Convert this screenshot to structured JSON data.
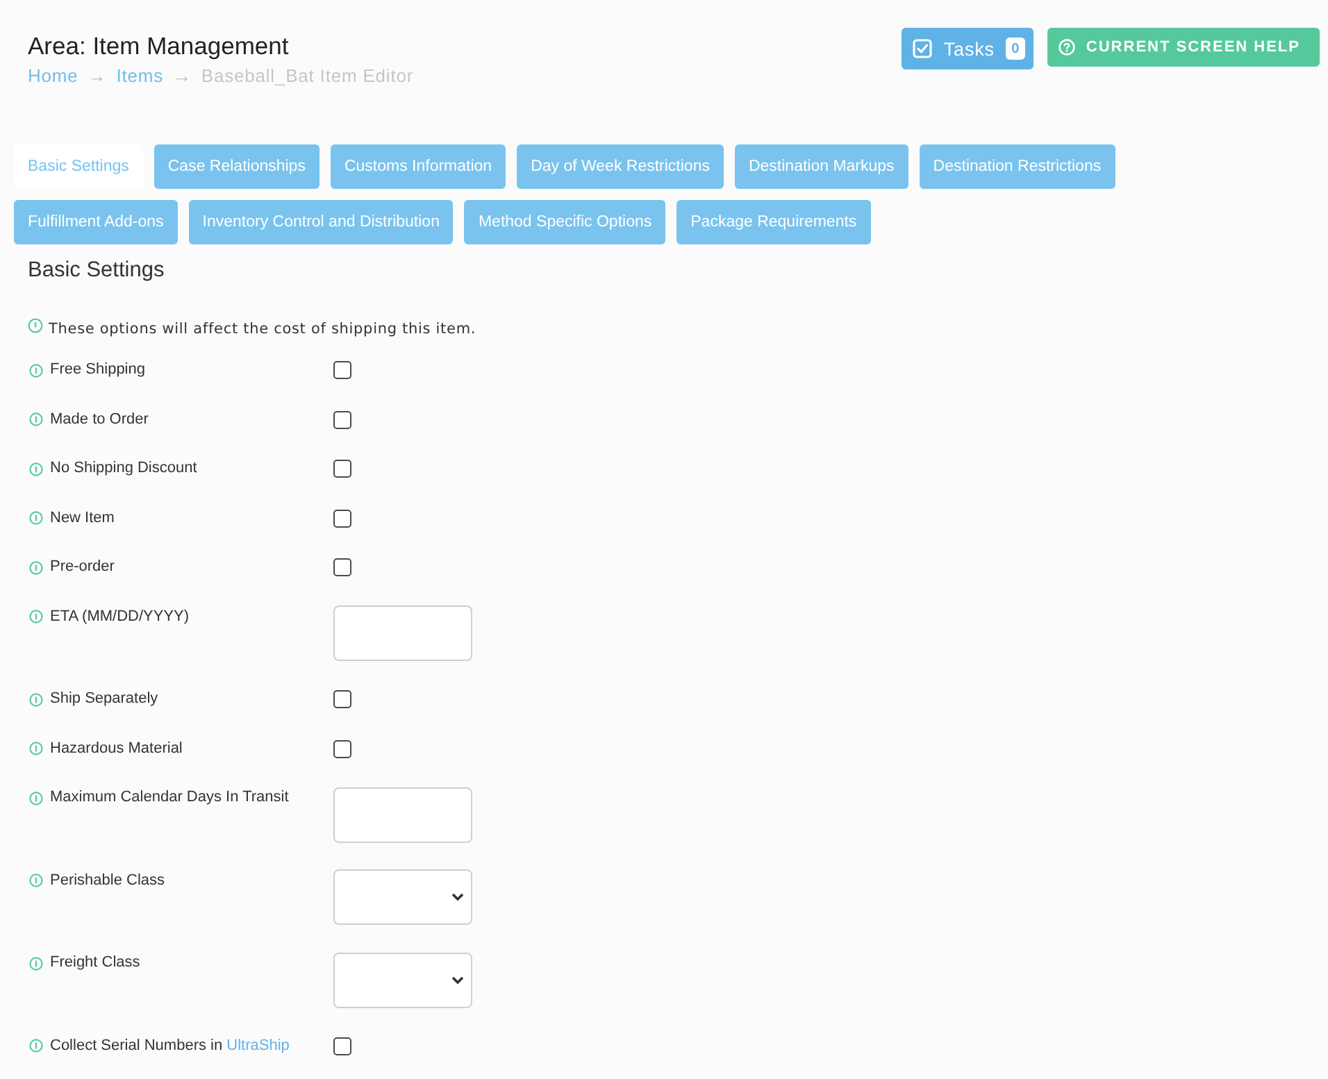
{
  "header": {
    "title": "Area: Item Management",
    "breadcrumb": [
      {
        "label": "Home",
        "kind": "link"
      },
      {
        "label": "→",
        "kind": "separator"
      },
      {
        "label": "Items",
        "kind": "link"
      },
      {
        "label": "→",
        "kind": "separator"
      },
      {
        "label": "Baseball_Bat Item Editor",
        "kind": "current"
      }
    ]
  },
  "actions": {
    "tasks": {
      "label": "Tasks",
      "count": "0"
    },
    "help": {
      "label": "CURRENT SCREEN HELP"
    }
  },
  "tabs": [
    {
      "label": "Basic Settings",
      "selected": true
    },
    {
      "label": "Case Relationships",
      "selected": false
    },
    {
      "label": "Customs Information",
      "selected": false
    },
    {
      "label": "Day of Week Restrictions",
      "selected": false
    },
    {
      "label": "Destination Markups",
      "selected": false
    },
    {
      "label": "Destination Restrictions",
      "selected": false
    },
    {
      "label": "Fulfillment Add-ons",
      "selected": false
    },
    {
      "label": "Inventory Control and Distribution",
      "selected": false
    },
    {
      "label": "Method Specific Options",
      "selected": false
    },
    {
      "label": "Package Requirements",
      "selected": false
    }
  ],
  "section": {
    "title": "Basic Settings",
    "note": "These options will affect the cost of shipping this item.",
    "fields": [
      {
        "label": "Free Shipping",
        "kind": "checkbox",
        "checked": false
      },
      {
        "label": "Made to Order",
        "kind": "checkbox",
        "checked": false
      },
      {
        "label": "No Shipping Discount",
        "kind": "checkbox",
        "checked": false
      },
      {
        "label": "New Item",
        "kind": "checkbox",
        "checked": false
      },
      {
        "label": "Pre-order",
        "kind": "checkbox",
        "checked": false
      },
      {
        "label": "ETA (MM/DD/YYYY)",
        "kind": "text"
      },
      {
        "label": "Ship Separately",
        "kind": "checkbox",
        "checked": false
      },
      {
        "label": "Hazardous Material",
        "kind": "checkbox",
        "checked": false
      },
      {
        "label": "Maximum Calendar Days In Transit",
        "kind": "text"
      },
      {
        "label": "Perishable Class",
        "kind": "select"
      },
      {
        "label": "Freight Class",
        "kind": "select"
      },
      {
        "label": "Collect Serial Numbers in",
        "link": "UltraShip",
        "kind": "checkbox",
        "checked": false
      }
    ]
  }
}
